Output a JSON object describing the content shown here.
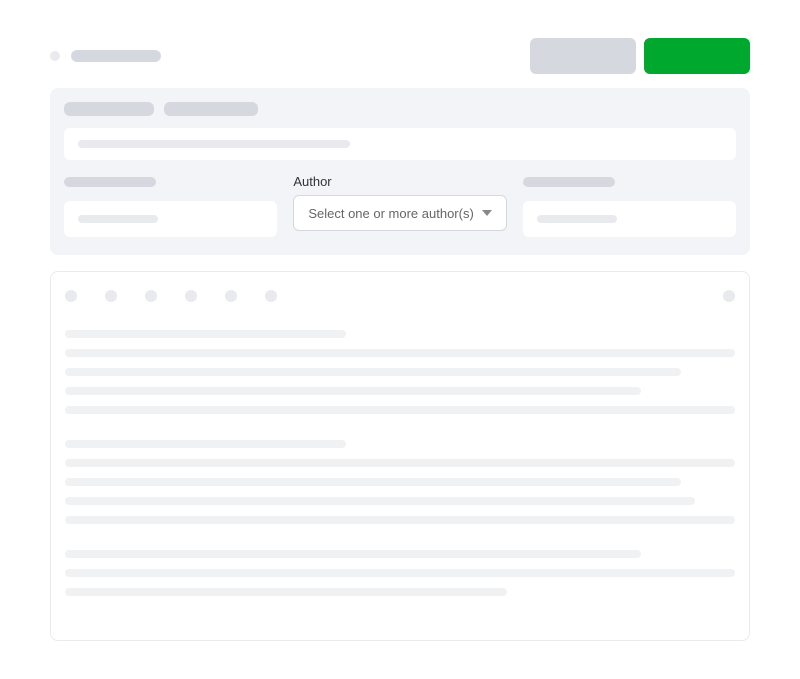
{
  "filters": {
    "author": {
      "label": "Author",
      "placeholder": "Select one or more author(s)"
    }
  }
}
